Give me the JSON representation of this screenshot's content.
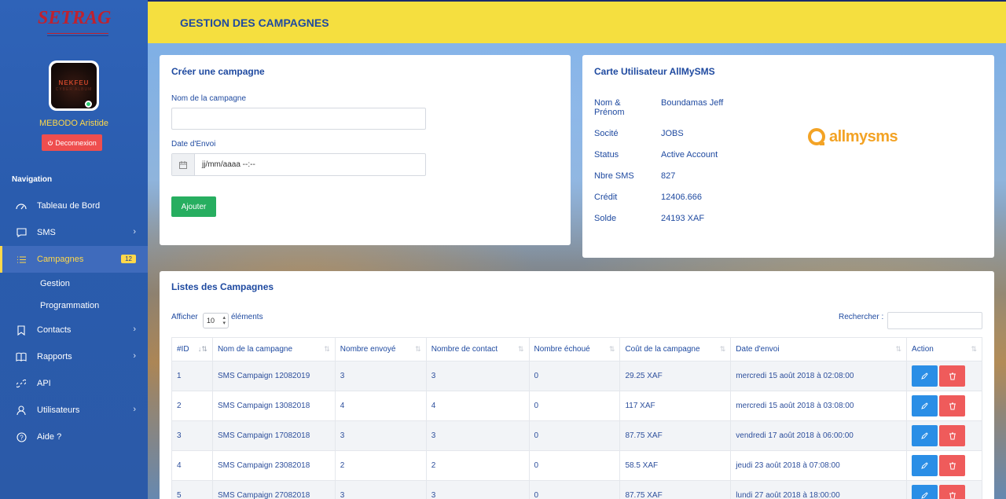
{
  "brand": {
    "logo_text": "SETRAG"
  },
  "user": {
    "name": "MEBODO Aristide",
    "avatar_text": "NEKFEU",
    "avatar_subtext": "CYBER ALBUM",
    "logout_label": "Deconnexion"
  },
  "nav": {
    "title": "Navigation",
    "items": [
      {
        "label": "Tableau de Bord",
        "icon": "dashboard-icon",
        "chevron": false
      },
      {
        "label": "SMS",
        "icon": "message-icon",
        "chevron": true
      },
      {
        "label": "Campagnes",
        "icon": "list-icon",
        "badge": "12",
        "active": true
      },
      {
        "label": "Contacts",
        "icon": "bookmark-icon",
        "chevron": true
      },
      {
        "label": "Rapports",
        "icon": "book-icon",
        "chevron": true
      },
      {
        "label": "API",
        "icon": "link-icon",
        "chevron": false
      },
      {
        "label": "Utilisateurs",
        "icon": "user-icon",
        "chevron": true
      },
      {
        "label": "Aide ?",
        "icon": "help-icon",
        "chevron": false
      }
    ],
    "subitems": [
      "Gestion",
      "Programmation"
    ]
  },
  "header": {
    "title": "GESTION DES CAMPAGNES"
  },
  "create": {
    "title": "Créer une campagne",
    "name_label": "Nom de la campagne",
    "name_value": "",
    "date_label": "Date d'Envoi",
    "date_placeholder": "jj/mm/aaaa --:--",
    "submit_label": "Ajouter"
  },
  "card": {
    "title": "Carte Utilisateur AllMySMS",
    "rows": [
      {
        "label": "Nom & Prénom",
        "value": "Boundamas Jeff"
      },
      {
        "label": "Socité",
        "value": "JOBS"
      },
      {
        "label": "Status",
        "value": "Active Account"
      },
      {
        "label": "Nbre SMS",
        "value": "827"
      },
      {
        "label": "Crédit",
        "value": "12406.666"
      },
      {
        "label": "Solde",
        "value": "24193 XAF"
      }
    ],
    "brand_text": "allmysms"
  },
  "list": {
    "title": "Listes des Campagnes",
    "show_label": "Afficher",
    "page_size": "10",
    "entries_label": "éléments",
    "search_label": "Rechercher :",
    "columns": [
      "#ID",
      "Nom de la campagne",
      "Nombre envoyé",
      "Nombre de contact",
      "Nombre échoué",
      "Coût de la campagne",
      "Date d'envoi",
      "Action"
    ],
    "rows": [
      [
        "1",
        "SMS Campaign 12082019",
        "3",
        "3",
        "0",
        "29.25 XAF",
        "mercredi 15 août 2018 à 02:08:00"
      ],
      [
        "2",
        "SMS Campaign 13082018",
        "4",
        "4",
        "0",
        "117 XAF",
        "mercredi 15 août 2018 à 03:08:00"
      ],
      [
        "3",
        "SMS Campaign 17082018",
        "3",
        "3",
        "0",
        "87.75 XAF",
        "vendredi 17 août 2018 à 06:00:00"
      ],
      [
        "4",
        "SMS Campaign 23082018",
        "2",
        "2",
        "0",
        "58.5 XAF",
        "jeudi 23 août 2018 à 07:08:00"
      ],
      [
        "5",
        "SMS Campaign 27082018",
        "3",
        "3",
        "0",
        "87.75 XAF",
        "lundi 27 août 2018 à 18:00:00"
      ]
    ]
  },
  "colors": {
    "header_yellow": "#f5df3f",
    "sidebar_blue": "#2f63b8",
    "accent_green": "#27ae60",
    "danger_red": "#ef5b5b",
    "edit_blue": "#2a8ee6"
  }
}
